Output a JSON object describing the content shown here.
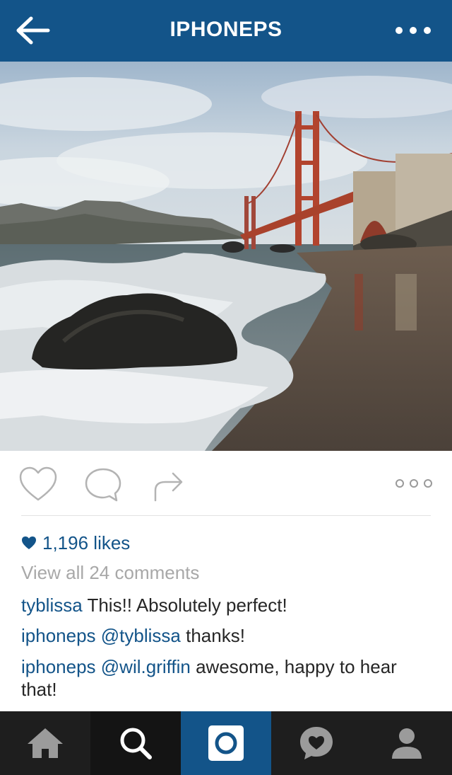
{
  "header": {
    "title": "IPHONEPS",
    "back_icon": "arrow-left-icon",
    "more_icon": "more-dots-icon",
    "background": "#135489"
  },
  "post": {
    "photo_icon": "golden-gate-photo",
    "likes_text": "1,196 likes",
    "view_all_text": "View all 24 comments",
    "comments": [
      {
        "user": "tyblissa",
        "mention": "",
        "text": "This!! Absolutely perfect!"
      },
      {
        "user": "iphoneps",
        "mention": "@tyblissa",
        "text": "thanks!"
      },
      {
        "user": "iphoneps",
        "mention": "@wil.griffin",
        "text": "awesome, happy to hear that!"
      }
    ],
    "accent_color": "#135489"
  },
  "actions": {
    "like_icon": "heart-outline-icon",
    "comment_icon": "comment-bubble-icon",
    "share_icon": "share-arrow-icon",
    "options_icon": "options-dots-icon"
  },
  "tabbar": {
    "tabs": [
      {
        "icon": "home-icon"
      },
      {
        "icon": "search-icon"
      },
      {
        "icon": "camera-icon",
        "active": true
      },
      {
        "icon": "activity-icon"
      },
      {
        "icon": "profile-icon"
      }
    ]
  }
}
